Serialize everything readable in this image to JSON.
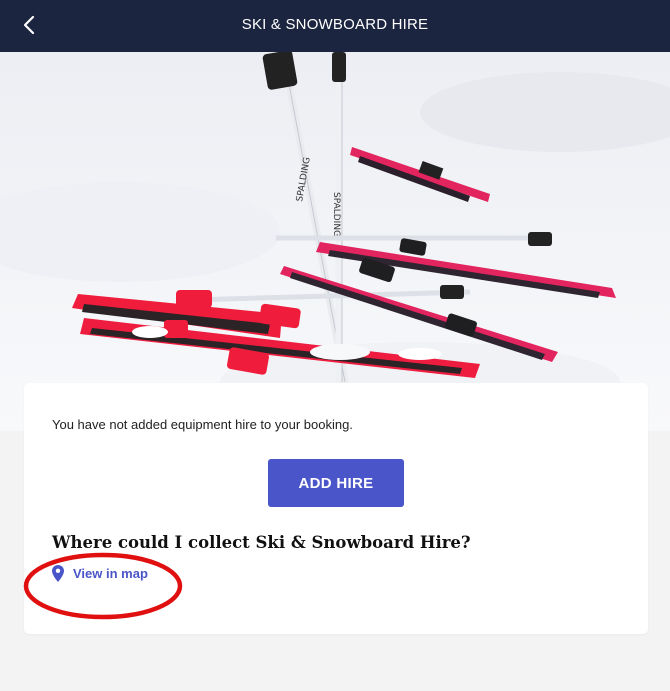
{
  "header": {
    "title": "SKI & SNOWBOARD HIRE",
    "back_icon": "chevron-left-icon"
  },
  "colors": {
    "header_bg": "#1c2540",
    "accent": "#4a55c9",
    "annotation": "#e01010"
  },
  "hire": {
    "message": "You have not added equipment hire to your booking.",
    "add_button_label": "ADD HIRE",
    "collect_question": "Where could I collect Ski & Snowboard Hire?",
    "map_link_label": "View in map",
    "map_link_icon": "map-pin-icon"
  }
}
